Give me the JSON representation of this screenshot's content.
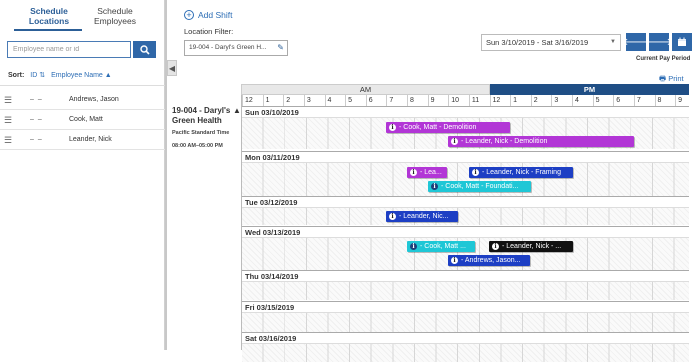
{
  "left_panel": {
    "tabs": [
      {
        "label": "Schedule\nLocations",
        "active": true
      },
      {
        "label": "Schedule\nEmployees",
        "active": false
      }
    ],
    "search": {
      "placeholder": "Employee name or id",
      "value": ""
    },
    "sort": {
      "label": "Sort:",
      "id": "ID",
      "employee_name": "Employee Name"
    },
    "employees": [
      {
        "id": "– –",
        "name": "Andrews, Jason"
      },
      {
        "id": "– –",
        "name": "Cook, Matt"
      },
      {
        "id": "– –",
        "name": "Leander, Nick"
      }
    ]
  },
  "header": {
    "add_shift": "Add Shift",
    "location_filter_label": "Location Filter:",
    "location_filter_value": "19-004 - Daryl's Green H...",
    "date_range": "Sun 3/10/2019 - Sat 3/16/2019",
    "current_pay_period": "Current Pay Period",
    "print": "Print"
  },
  "location": {
    "name_line1": "19-004 - Daryl's",
    "name_line2": "Green Health",
    "timezone": "Pacific Standard Time",
    "hours": "08:00 AM–05:00 PM"
  },
  "timeline": {
    "am_label": "AM",
    "pm_label": "PM",
    "hours": [
      "12",
      "1",
      "2",
      "3",
      "4",
      "5",
      "6",
      "7",
      "8",
      "9",
      "10",
      "11",
      "12",
      "1",
      "2",
      "3",
      "4",
      "5",
      "6",
      "7",
      "8",
      "9"
    ]
  },
  "days": [
    {
      "label": "Sun 03/10/2019",
      "shifts": [
        {
          "text": "- Cook, Matt - Demolition",
          "color": "#b236d6"
        },
        {
          "text": "- Leander, Nick - Demolition",
          "color": "#b236d6"
        }
      ]
    },
    {
      "label": "Mon 03/11/2019",
      "shifts": [
        {
          "text": "- Lea...",
          "color": "#b236d6"
        },
        {
          "text": "- Leander, Nick - Framing",
          "color": "#1d3fc4"
        },
        {
          "text": "- Cook, Matt - Foundati...",
          "color": "#1fc7d6"
        }
      ]
    },
    {
      "label": "Tue 03/12/2019",
      "shifts": [
        {
          "text": "- Leander, Nic...",
          "color": "#1d3fc4"
        }
      ]
    },
    {
      "label": "Wed 03/13/2019",
      "shifts": [
        {
          "text": "- Cook, Matt ...",
          "color": "#1fc7d6"
        },
        {
          "text": "- Leander, Nick - ...",
          "color": "#111111"
        },
        {
          "text": "- Andrews, Jason...",
          "color": "#1d3fc4"
        }
      ]
    },
    {
      "label": "Thu 03/14/2019",
      "shifts": []
    },
    {
      "label": "Fri 03/15/2019",
      "shifts": []
    },
    {
      "label": "Sat 03/16/2019",
      "shifts": []
    }
  ]
}
